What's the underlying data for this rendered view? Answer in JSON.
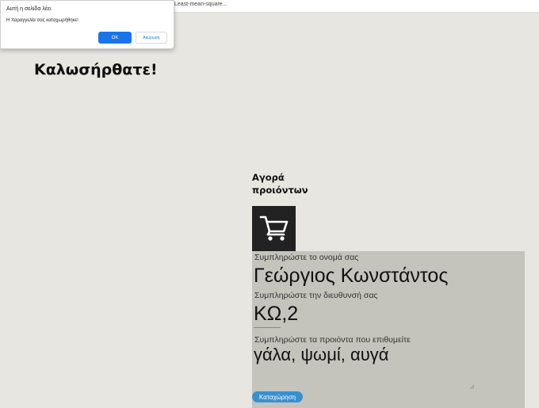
{
  "browser": {
    "bookmark_label": "Least-mean-square..."
  },
  "alert": {
    "title": "Αυτή η σελίδα λέει",
    "message": "Η παραγγελία σας καταχωρήθηκε!",
    "ok_label": "OK",
    "cancel_label": "Ακύρωση"
  },
  "page": {
    "welcome": "Καλωσήρθατε!",
    "section_title": "Αγορά προιόντων",
    "cart_icon": "shopping-cart-icon"
  },
  "form": {
    "name_label": "Συμπληρώστε το ονομά σας",
    "name_value": "Γεώργιος Κωνστάντος",
    "address_label": "Συμπληρώστε την διευθυνσή σας",
    "address_value": "ΚΩ,2",
    "products_label": "Συμπληρώστε τα προιόντα που επιθυμείτε",
    "products_value": "γάλα, ψωμί, αυγά",
    "submit_label": "Καταχώρηση"
  },
  "colors": {
    "page_bg": "#e8e6e1",
    "panel_bg": "#c4c3bc",
    "cart_bg": "#222222",
    "button_blue": "#3a8fcf",
    "dialog_ok": "#1a73e8"
  }
}
